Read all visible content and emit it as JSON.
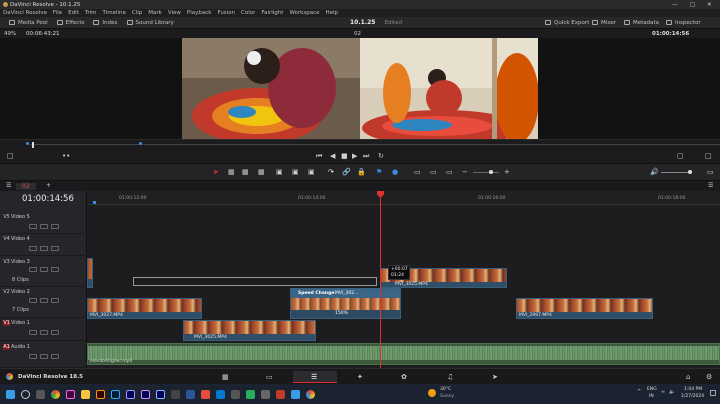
{
  "app": {
    "title": "DaVinci Resolve - 10.1.25"
  },
  "menu": [
    "DaVinci Resolve",
    "File",
    "Edit",
    "Trim",
    "Timeline",
    "Clip",
    "Mark",
    "View",
    "Playback",
    "Fusion",
    "Color",
    "Fairlight",
    "Workspace",
    "Help"
  ],
  "toolbar": {
    "left": [
      "Media Pool",
      "Effects",
      "Index",
      "Sound Library"
    ],
    "project": "10.1.25",
    "status": "Edited",
    "right": [
      "Quick Export",
      "Mixer",
      "Metadata",
      "Inspector"
    ]
  },
  "viewer": {
    "zoom": "49%",
    "source_timecode": "00:06:43:21",
    "clip_name": "02",
    "record_timecode": "01:00:14:56"
  },
  "timeline": {
    "timecode": "01:00:14:56",
    "tab_name": "02",
    "ruler": [
      "01:00:12:00",
      "01:00:14:00",
      "01:00:16:00",
      "01:00:18:00"
    ],
    "tracks": [
      {
        "id": "V5",
        "name": "Video 5",
        "clips": ""
      },
      {
        "id": "V4",
        "name": "Video 4",
        "clips": ""
      },
      {
        "id": "V3",
        "name": "Video 3",
        "clips": "8 Clips"
      },
      {
        "id": "V2",
        "name": "Video 2",
        "clips": "7 Clips"
      },
      {
        "id": "V1",
        "name": "Video 1",
        "clips": ""
      },
      {
        "id": "A1",
        "name": "Audio 1",
        "clips": ""
      }
    ],
    "clips": {
      "v3_clip": "MVI_3025.MP4",
      "v2_clip_a": "MVI_3027.MP4",
      "v2_speed": "Speed Change",
      "v2_speed_clip": "MVI_302...",
      "v2_speed_pct": "150%",
      "v2_clip_c": "MVI_2997.MP4",
      "v1_clip": "MVI_3025.MP4",
      "audio_clip": "elevatehigher.mp4"
    },
    "tooltip": {
      "delta": "+00:07",
      "duration": "01:24"
    }
  },
  "footer": {
    "brand": "DaVinci Resolve 18.5"
  },
  "taskbar": {
    "weather_temp": "30°C",
    "weather_desc": "Sunny",
    "lang1": "ENG",
    "lang2": "IN",
    "time": "1:04 PM",
    "date": "1/27/2024"
  },
  "colors": {
    "accent": "#e03030",
    "clip_blue": "#2f4e68",
    "audio_green": "#3c5b3c"
  }
}
